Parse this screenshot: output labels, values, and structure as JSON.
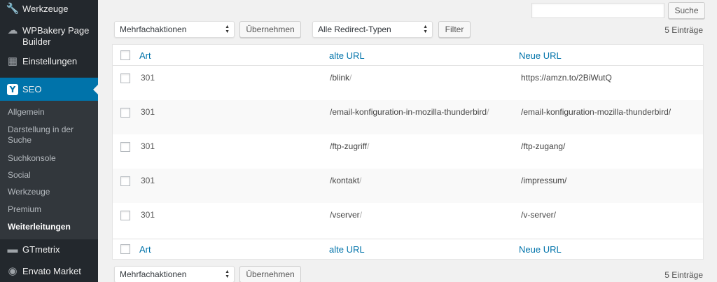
{
  "sidebar": {
    "items": [
      {
        "label": "Werkzeuge",
        "icon": "wrench-icon"
      },
      {
        "label": "WPBakery Page Builder",
        "line1": "WPBakery Page",
        "line2": "Builder",
        "icon": "wpbakery-cloud-icon"
      },
      {
        "label": "Einstellungen",
        "icon": "settings-sliders-icon"
      },
      {
        "label": "SEO",
        "icon": "yoast-icon",
        "badge": "Y"
      },
      {
        "label": "GTmetrix",
        "icon": "gtmetrix-icon"
      },
      {
        "label": "Envato Market",
        "icon": "envato-fingerprint-icon"
      }
    ],
    "submenu": [
      {
        "label": "Allgemein"
      },
      {
        "label": "Darstellung in der Suche",
        "line1": "Darstellung in der",
        "line2": "Suche"
      },
      {
        "label": "Suchkonsole"
      },
      {
        "label": "Social"
      },
      {
        "label": "Werkzeuge"
      },
      {
        "label": "Premium"
      },
      {
        "label": "Weiterleitungen",
        "current": true
      }
    ]
  },
  "search": {
    "value": "",
    "button_label": "Suche"
  },
  "toolbar_top": {
    "bulk_select": "Mehrfachaktionen",
    "apply_label": "Übernehmen",
    "type_select": "Alle Redirect-Typen",
    "filter_label": "Filter",
    "count": "5 Einträge"
  },
  "toolbar_bottom": {
    "bulk_select": "Mehrfachaktionen",
    "apply_label": "Übernehmen",
    "count": "5 Einträge"
  },
  "table": {
    "columns": [
      "Art",
      "alte URL",
      "Neue URL"
    ],
    "rows": [
      {
        "type": "301",
        "old": "/blink",
        "new": "https://amzn.to/2BiWutQ"
      },
      {
        "type": "301",
        "old": "/email-konfiguration-in-mozilla-thunderbird",
        "new": "/email-konfiguration-mozilla-thunderbird/"
      },
      {
        "type": "301",
        "old": "/ftp-zugriff",
        "new": "/ftp-zugang/"
      },
      {
        "type": "301",
        "old": "/kontakt",
        "new": "/impressum/"
      },
      {
        "type": "301",
        "old": "/vserver",
        "new": "/v-server/"
      }
    ],
    "trailing_slash": "/"
  },
  "colors": {
    "sidebar_bg": "#23282d",
    "submenu_bg": "#32373c",
    "accent": "#0073aa",
    "link": "#0073aa"
  }
}
